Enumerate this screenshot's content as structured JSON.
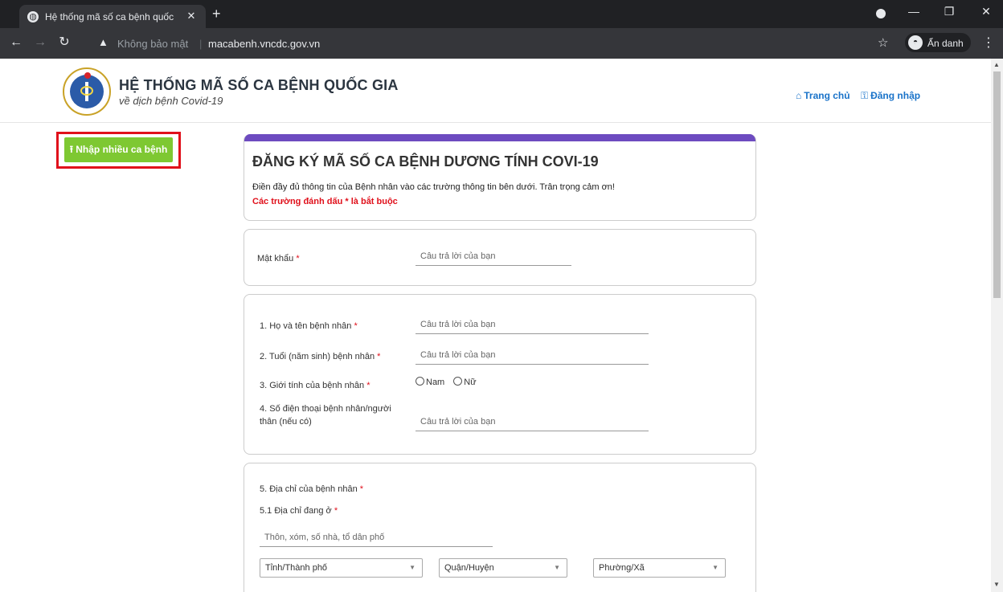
{
  "browser": {
    "tab_title": "Hệ thống mã số ca bệnh quốc gi",
    "tab_close": "✕",
    "new_tab": "+",
    "security_label": "Không bảo mật",
    "url": "macabenh.vncdc.gov.vn",
    "incognito_label": "Ẩn danh"
  },
  "header": {
    "site_title": "HỆ THỐNG MÃ SỐ CA BỆNH QUỐC GIA",
    "site_subtitle": "về dịch bệnh Covid-19",
    "nav_home": "Trang chủ",
    "nav_login": "Đăng nhập"
  },
  "sidebar": {
    "import_button": "Nhập nhiều ca bệnh"
  },
  "form": {
    "title": "ĐĂNG KÝ MÃ SỐ CA BỆNH DƯƠNG TÍNH COVI-19",
    "description": "Điền đầy đủ thông tin của Bệnh nhân vào các trường thông tin bên dưới. Trân trọng cảm ơn!",
    "required_note": "Các trường đánh dấu * là bắt buộc",
    "required_mark": "*",
    "placeholder": "Câu trả lời của bạn",
    "password_label": "Mật khẩu",
    "q1_label": "1. Họ và tên bệnh nhân",
    "q2_label": "2. Tuổi (năm sinh) bệnh nhân",
    "q3_label": "3. Giới tính của bệnh nhân",
    "q3_options": [
      "Nam",
      "Nữ"
    ],
    "q4_label_line1": "4. Số điện thoại bệnh nhân/người",
    "q4_label_line2": "thân (nếu có)",
    "q5_label": "5. Địa chỉ của bệnh nhân",
    "q5_1_label": "5.1 Địa chỉ đang ở",
    "q5_1_placeholder": "Thôn, xóm, số nhà, tổ dân phố",
    "province_select": "Tỉnh/Thành phố",
    "district_select": "Quận/Huyện",
    "ward_select": "Phường/Xã"
  }
}
